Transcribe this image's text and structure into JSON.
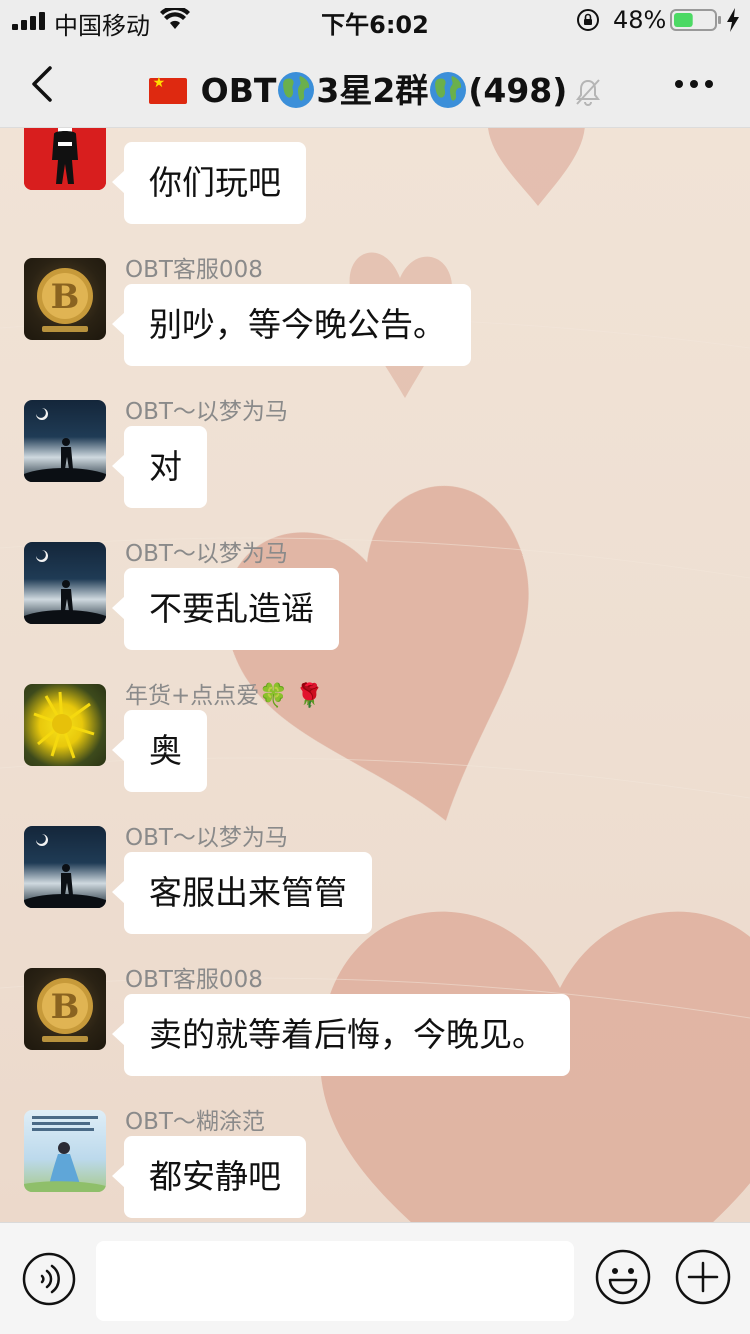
{
  "status_bar": {
    "carrier": "中国移动",
    "time": "下午6:02",
    "battery_percent": "48%",
    "battery_level": 0.48
  },
  "nav": {
    "title_prefix": "OBT",
    "title_middle": "3星2群",
    "member_count": "(498)",
    "muted": true
  },
  "colors": {
    "bubble": "#ffffff",
    "sender_name": "#8a8a8a",
    "heart": "#dca896",
    "battery_fill": "#4cd964"
  },
  "messages": [
    {
      "sender": "",
      "avatar": "red-figure-avatar",
      "text": "你们玩吧"
    },
    {
      "sender": "OBT客服008",
      "avatar": "bitcoin-coin-avatar",
      "text": "别吵，等今晚公告。"
    },
    {
      "sender": "OBT～以梦为马",
      "avatar": "night-silhouette-avatar",
      "text": "对"
    },
    {
      "sender": "OBT～以梦为马",
      "avatar": "night-silhouette-avatar",
      "text": "不要乱造谣"
    },
    {
      "sender": "年货+点点爱🍀 🌹",
      "avatar": "dandelion-avatar",
      "text": "奥"
    },
    {
      "sender": "OBT～以梦为马",
      "avatar": "night-silhouette-avatar",
      "text": "客服出来管管"
    },
    {
      "sender": "OBT客服008",
      "avatar": "bitcoin-coin-avatar",
      "text": "卖的就等着后悔，今晚见。"
    },
    {
      "sender": "OBT～糊涂范",
      "avatar": "girl-illustration-avatar",
      "text": "都安静吧"
    }
  ],
  "input_bar": {
    "value": "",
    "voice_icon": "voice-icon",
    "emoji_icon": "emoji-icon",
    "plus_icon": "plus-icon"
  }
}
